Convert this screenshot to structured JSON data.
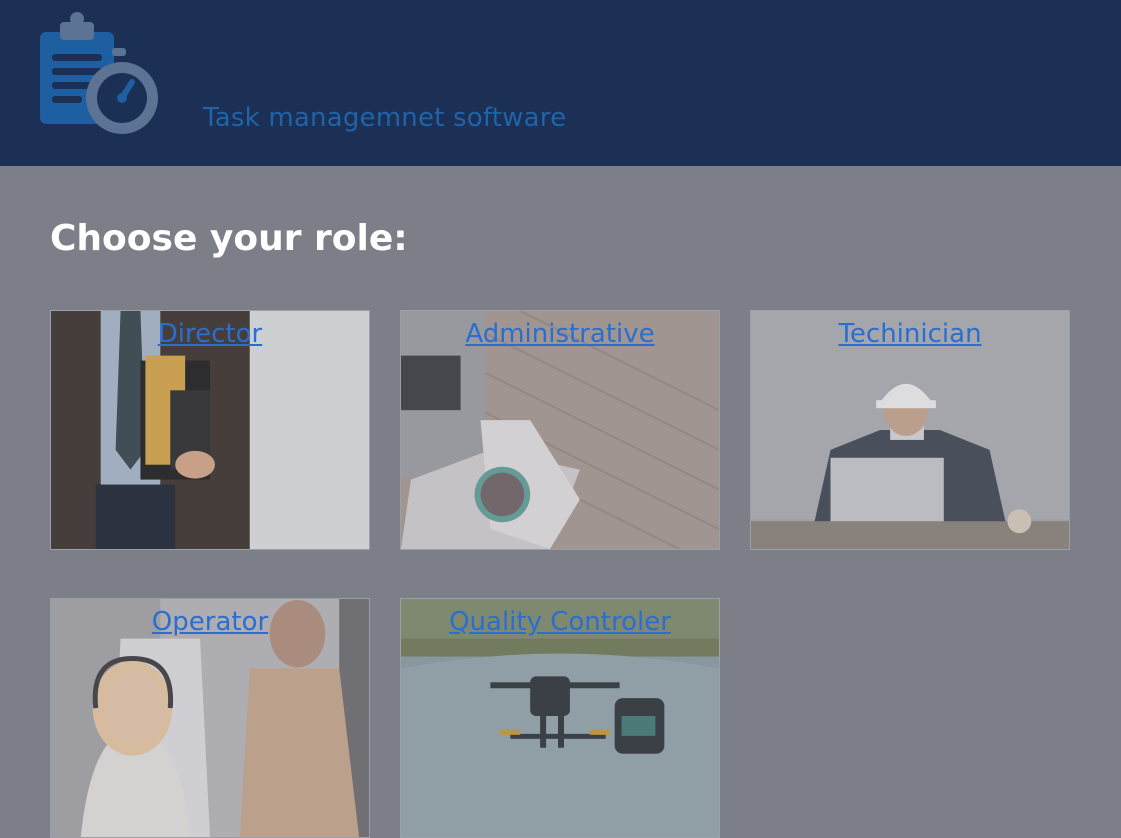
{
  "header": {
    "app_title": "Task managemnet software",
    "logo_icon": "clipboard-stopwatch-icon"
  },
  "main": {
    "heading": "Choose your role:",
    "roles": [
      {
        "label": "Director"
      },
      {
        "label": "Administrative"
      },
      {
        "label": "Techinician"
      },
      {
        "label": "Operator"
      },
      {
        "label": "Quality Controler"
      }
    ]
  },
  "colors": {
    "header_bg": "#1c3055",
    "page_bg": "#7d7f88",
    "link": "#2a6ecf",
    "title": "#1f63a8"
  }
}
